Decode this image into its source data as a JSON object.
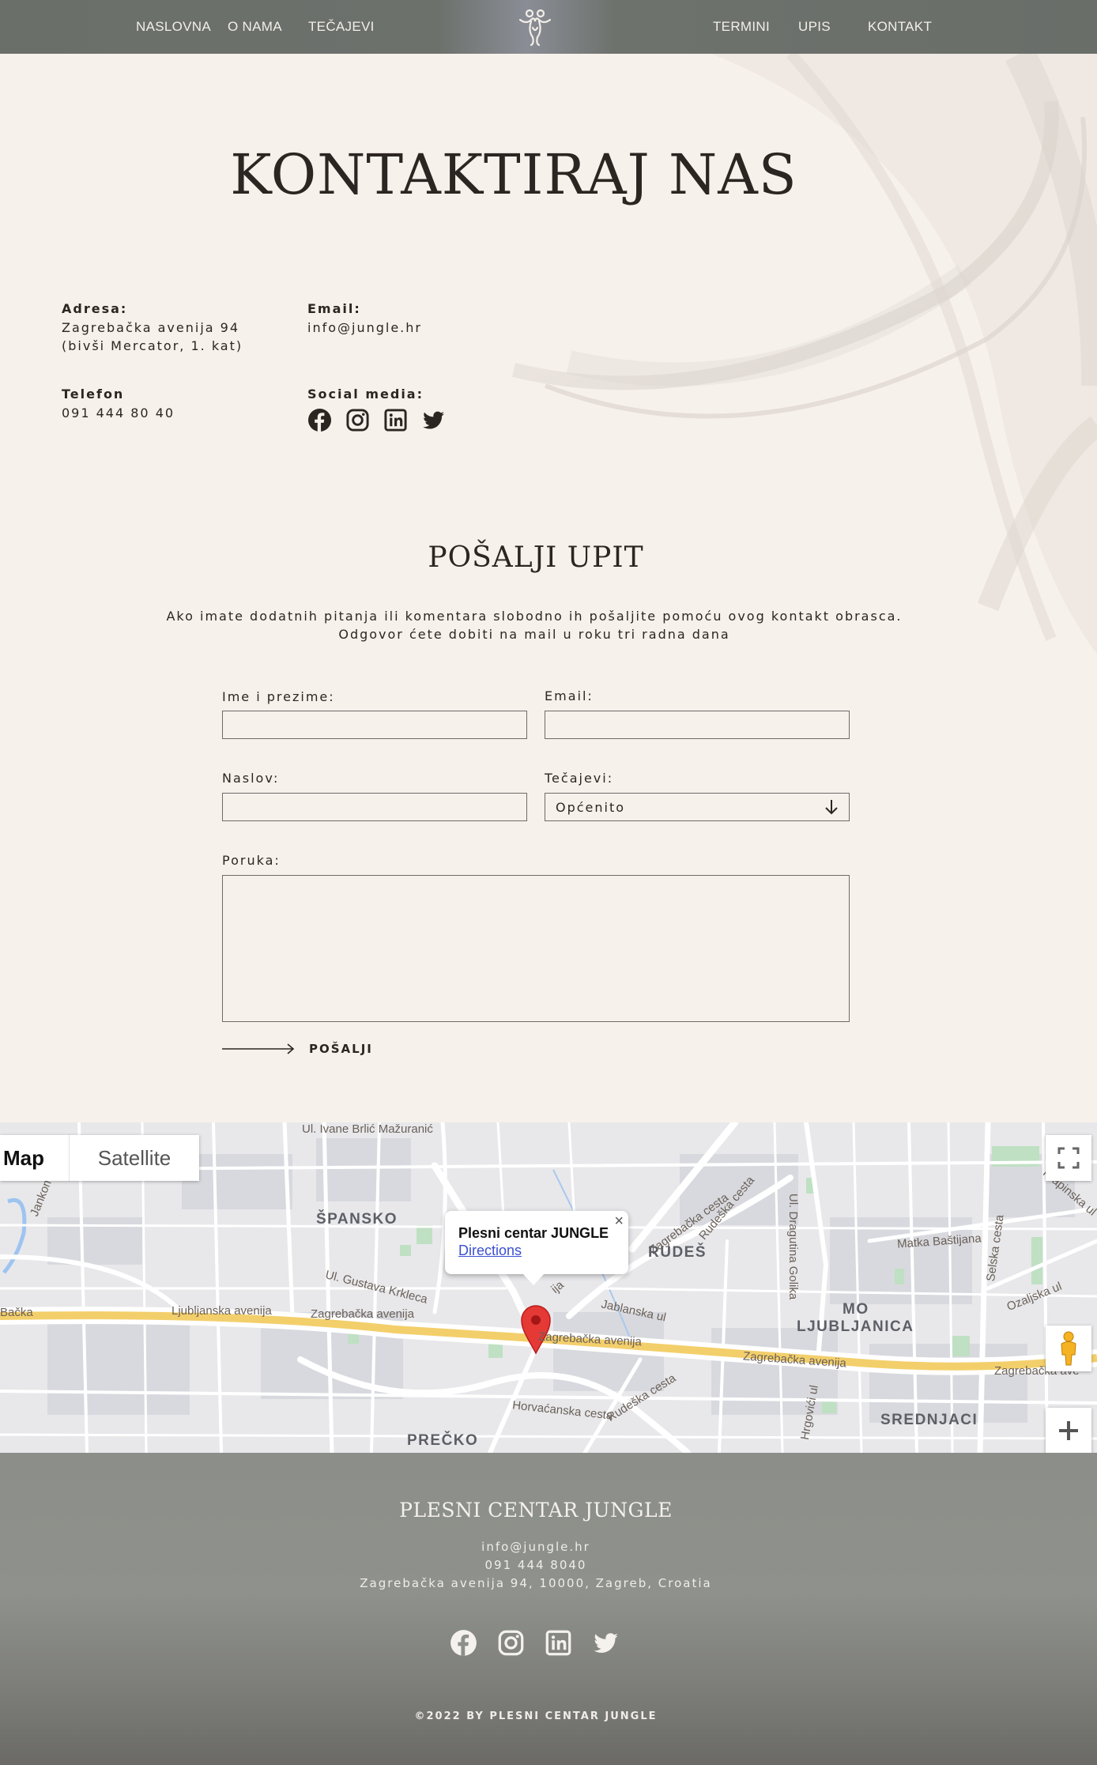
{
  "nav": {
    "items_left": [
      "NASLOVNA",
      "O NAMA",
      "TEČAJEVI"
    ],
    "items_right": [
      "TERMINI",
      "UPIS",
      "KONTAKT"
    ],
    "logo_icon": "dancing-couple-logo"
  },
  "hero": {
    "title": "KONTAKTIRAJ NAS"
  },
  "contact": {
    "address_label": "Adresa:",
    "address_line1": "Zagrebačka avenija 94",
    "address_line2": "(bivši Mercator, 1. kat)",
    "email_label": "Email:",
    "email_value": "info@jungle.hr",
    "phone_label": "Telefon",
    "phone_value": "091 444 80 40",
    "social_label": "Social media:",
    "social_icons": [
      "facebook-icon",
      "instagram-icon",
      "linkedin-icon",
      "twitter-icon"
    ]
  },
  "form": {
    "title": "POŠALJI UPIT",
    "desc_line1": "Ako imate dodatnih pitanja ili komentara slobodno ih pošaljite pomoću ovog kontakt obrasca.",
    "desc_line2": "Odgovor ćete dobiti na mail u roku tri radna dana",
    "name_label": "Ime i prezime:",
    "email_label": "Email:",
    "subject_label": "Naslov:",
    "courses_label": "Tečajevi:",
    "courses_selected": "Općenito",
    "message_label": "Poruka:",
    "submit_label": "POŠALJI"
  },
  "map": {
    "type_map": "Map",
    "type_satellite": "Satellite",
    "popup_title": "Plesni centar JUNGLE",
    "popup_link": "Directions",
    "popup_close": "×",
    "districts": [
      "ŠPANSKO",
      "RUDEŠ",
      "MO",
      "LJUBLJANICA",
      "SREDNJACI",
      "PREČKO"
    ],
    "streets": [
      "Ul. Ivane Brlić Mažuranić",
      "Jankomir",
      "Ljubljanska avenija",
      "Zagrebačka avenija",
      "Zagrebačka avenija",
      "Zagrebačka avenija",
      "Zagrebačka ave",
      "Ul. Gustava Krkleca",
      "Zagrebačka cesta",
      "Rudeška cesta",
      "Ul. Dragutina Golika",
      "Matka Baštijana",
      "Krapinska ul",
      "Selska cesta",
      "Ozaljska ul",
      "Jablanska ul",
      "Rudeška cesta",
      "Horvaćanska cesta",
      "Hrgovići ul",
      "ija",
      "Bačka"
    ],
    "accent_road": "#f3cf6b",
    "pin_color": "#e53935"
  },
  "footer": {
    "title": "PLESNI CENTAR JUNGLE",
    "email": "info@jungle.hr",
    "phone": "091 444 8040",
    "address": "Zagrebačka avenija 94, 10000, Zagreb, Croatia",
    "copyright": "©2022 BY PLESNI CENTAR JUNGLE"
  }
}
